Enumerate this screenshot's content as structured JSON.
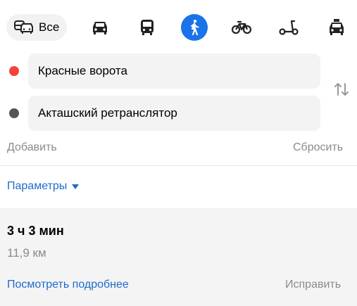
{
  "modes": {
    "all_label": "Все",
    "active": "pedestrian",
    "accent_color": "#1a73e8"
  },
  "route": {
    "point_a": "Красные ворота",
    "point_b": "Акташский ретранслятор",
    "point_a_color": "#f44336",
    "point_b_color": "#555555"
  },
  "actions": {
    "add": "Добавить",
    "reset": "Сбросить",
    "params": "Параметры"
  },
  "result": {
    "duration": "3 ч 3 мин",
    "distance": "11,9 км",
    "details_link": "Посмотреть подробнее",
    "fix_link": "Исправить"
  }
}
